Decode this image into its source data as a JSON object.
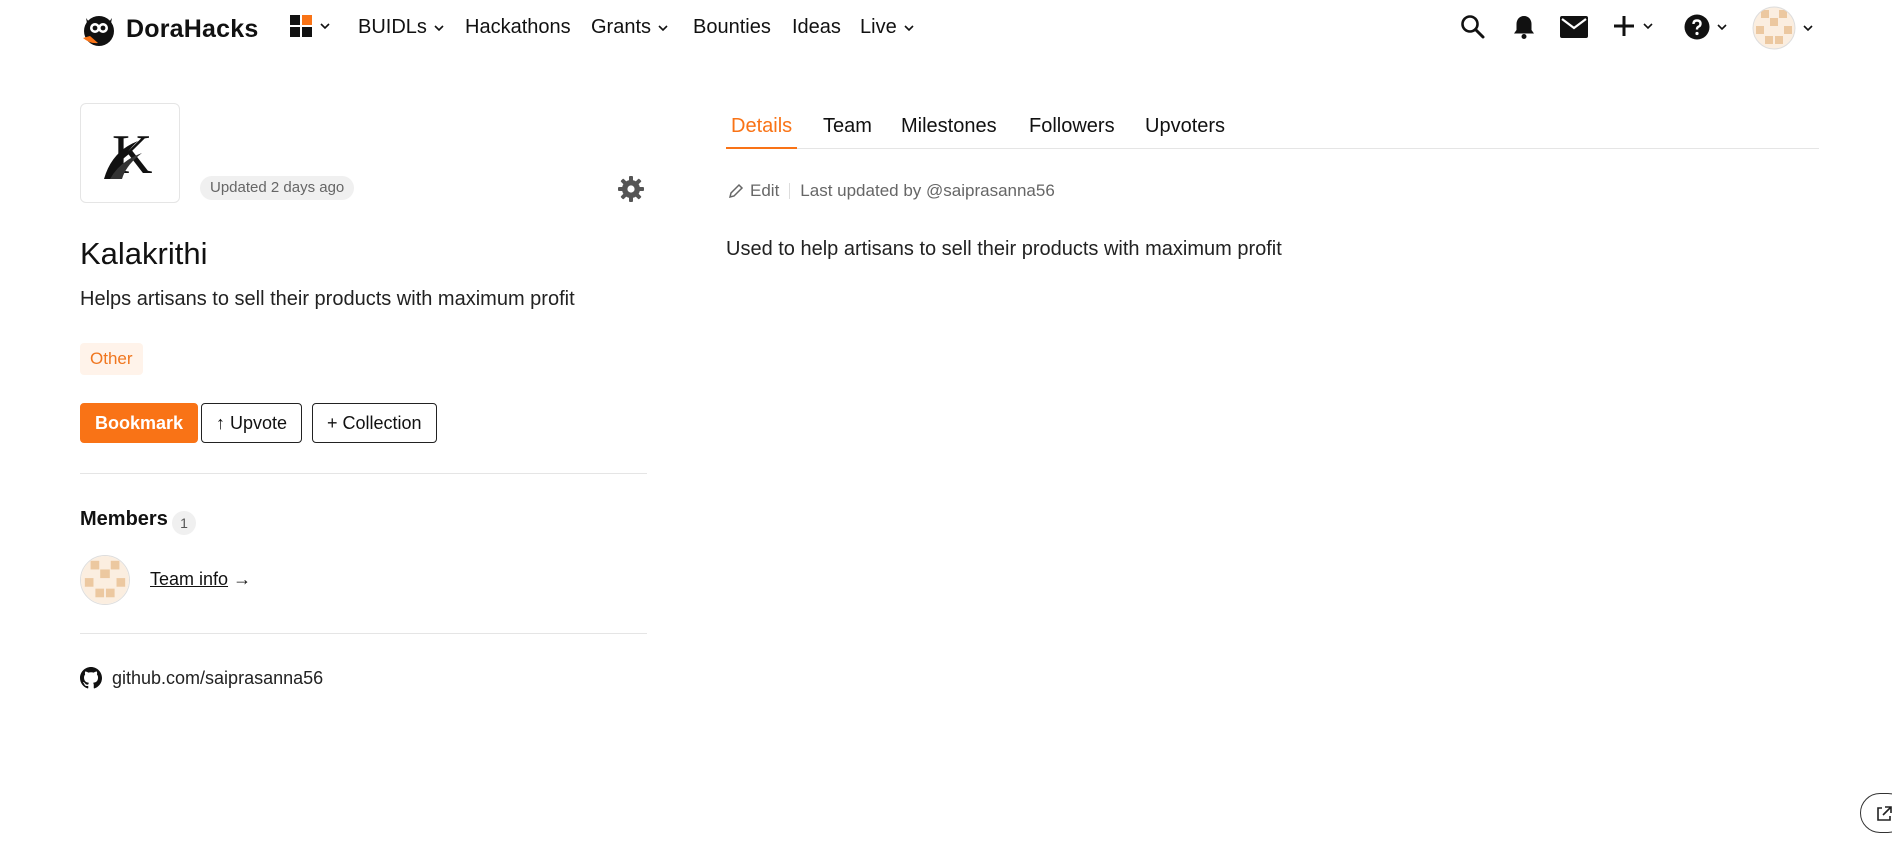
{
  "brand": {
    "name": "DoraHacks"
  },
  "nav": {
    "items": [
      {
        "label": "BUIDLs"
      },
      {
        "label": "Hackathons"
      },
      {
        "label": "Grants"
      },
      {
        "label": "Bounties"
      },
      {
        "label": "Ideas"
      },
      {
        "label": "Live"
      }
    ]
  },
  "colors": {
    "accent": "#f97316",
    "tag_bg": "#fff3ea"
  },
  "project": {
    "logo_letter": "K",
    "updated_badge": "Updated 2 days ago",
    "title": "Kalakrithi",
    "subtitle": "Helps artisans to sell their products with maximum profit",
    "tag": "Other",
    "buttons": {
      "bookmark": "Bookmark",
      "upvote": "↑ Upvote",
      "collection": "+ Collection"
    },
    "members": {
      "label": "Members",
      "count": "1",
      "team_info": "Team info",
      "arrow": "→"
    },
    "github": "github.com/saiprasanna56"
  },
  "details": {
    "tabs": [
      {
        "label": "Details",
        "active": true
      },
      {
        "label": "Team"
      },
      {
        "label": "Milestones"
      },
      {
        "label": "Followers"
      },
      {
        "label": "Upvoters"
      }
    ],
    "edit_label": "Edit",
    "last_updated": "Last updated by @saiprasanna56",
    "description": "Used to help artisans to sell their products with maximum profit"
  },
  "icons": [
    "dorahacks-logo-icon",
    "apps-grid-icon",
    "search-icon",
    "bell-icon",
    "mail-icon",
    "plus-icon",
    "help-icon",
    "gear-icon",
    "pencil-icon",
    "github-icon",
    "share-icon"
  ]
}
